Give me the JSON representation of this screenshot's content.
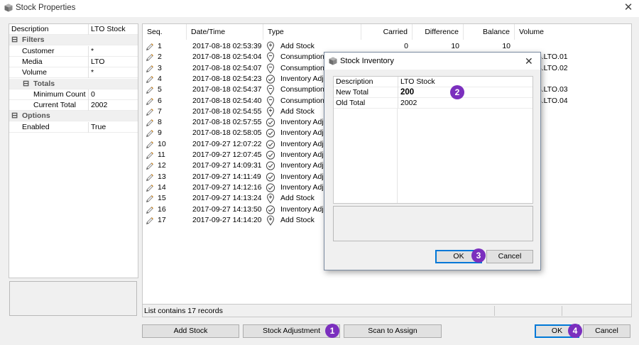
{
  "window": {
    "title": "Stock Properties",
    "close_glyph": "✕"
  },
  "properties": {
    "rows": [
      {
        "name": "Description",
        "value": "LTO Stock",
        "category": false,
        "toggle": "",
        "indent": 0
      },
      {
        "name": "Filters",
        "value": "",
        "category": true,
        "toggle": "⊟",
        "indent": 0
      },
      {
        "name": "Customer",
        "value": "*",
        "category": false,
        "toggle": "",
        "indent": 1
      },
      {
        "name": "Media",
        "value": "LTO",
        "category": false,
        "toggle": "",
        "indent": 1
      },
      {
        "name": "Volume",
        "value": "*",
        "category": false,
        "toggle": "",
        "indent": 1
      },
      {
        "name": "Totals",
        "value": "",
        "category": true,
        "toggle": "⊟",
        "indent": 1
      },
      {
        "name": "Minimum Count",
        "value": "0",
        "category": false,
        "toggle": "",
        "indent": 2
      },
      {
        "name": "Current Total",
        "value": "2002",
        "category": false,
        "toggle": "",
        "indent": 2
      },
      {
        "name": "Options",
        "value": "",
        "category": true,
        "toggle": "⊟",
        "indent": 0
      },
      {
        "name": "Enabled",
        "value": "True",
        "category": false,
        "toggle": "",
        "indent": 1
      }
    ]
  },
  "list": {
    "columns": [
      "Seq.",
      "Date/Time",
      "Type",
      "Carried",
      "Difference",
      "Balance",
      "Volume"
    ],
    "rows": [
      {
        "seq": "1",
        "datetime": "2017-08-18 02:53:39",
        "type": "Add Stock",
        "icon": "add-stock-icon",
        "carried": "0",
        "difference": "10",
        "balance": "10",
        "volume": ""
      },
      {
        "seq": "2",
        "datetime": "2017-08-18 02:54:04",
        "type": "Consumption",
        "icon": "consumption-icon",
        "carried": "",
        "difference": "",
        "balance": "",
        "volume": "18.LTO.01"
      },
      {
        "seq": "3",
        "datetime": "2017-08-18 02:54:07",
        "type": "Consumption",
        "icon": "consumption-icon",
        "carried": "",
        "difference": "",
        "balance": "",
        "volume": "18.LTO.02"
      },
      {
        "seq": "4",
        "datetime": "2017-08-18 02:54:23",
        "type": "Inventory Adju",
        "icon": "inventory-adjustment-icon",
        "carried": "",
        "difference": "",
        "balance": "",
        "volume": ""
      },
      {
        "seq": "5",
        "datetime": "2017-08-18 02:54:37",
        "type": "Consumption",
        "icon": "consumption-icon",
        "carried": "",
        "difference": "",
        "balance": "",
        "volume": "18.LTO.03"
      },
      {
        "seq": "6",
        "datetime": "2017-08-18 02:54:40",
        "type": "Consumption",
        "icon": "consumption-icon",
        "carried": "",
        "difference": "",
        "balance": "",
        "volume": "18.LTO.04"
      },
      {
        "seq": "7",
        "datetime": "2017-08-18 02:54:55",
        "type": "Add Stock",
        "icon": "add-stock-icon",
        "carried": "",
        "difference": "",
        "balance": "",
        "volume": ""
      },
      {
        "seq": "8",
        "datetime": "2017-08-18 02:57:55",
        "type": "Inventory Adju",
        "icon": "inventory-adjustment-icon",
        "carried": "",
        "difference": "",
        "balance": "",
        "volume": ""
      },
      {
        "seq": "9",
        "datetime": "2017-08-18 02:58:05",
        "type": "Inventory Adju",
        "icon": "inventory-adjustment-icon",
        "carried": "",
        "difference": "",
        "balance": "",
        "volume": ""
      },
      {
        "seq": "10",
        "datetime": "2017-09-27 12:07:22",
        "type": "Inventory Adju",
        "icon": "inventory-adjustment-icon",
        "carried": "",
        "difference": "",
        "balance": "",
        "volume": ""
      },
      {
        "seq": "11",
        "datetime": "2017-09-27 12:07:45",
        "type": "Inventory Adju",
        "icon": "inventory-adjustment-icon",
        "carried": "",
        "difference": "",
        "balance": "",
        "volume": ""
      },
      {
        "seq": "12",
        "datetime": "2017-09-27 14:09:31",
        "type": "Inventory Adju",
        "icon": "inventory-adjustment-icon",
        "carried": "",
        "difference": "",
        "balance": "",
        "volume": ""
      },
      {
        "seq": "13",
        "datetime": "2017-09-27 14:11:49",
        "type": "Inventory Adju",
        "icon": "inventory-adjustment-icon",
        "carried": "",
        "difference": "",
        "balance": "",
        "volume": ""
      },
      {
        "seq": "14",
        "datetime": "2017-09-27 14:12:16",
        "type": "Inventory Adju",
        "icon": "inventory-adjustment-icon",
        "carried": "",
        "difference": "",
        "balance": "",
        "volume": ""
      },
      {
        "seq": "15",
        "datetime": "2017-09-27 14:13:24",
        "type": "Add Stock",
        "icon": "add-stock-icon",
        "carried": "",
        "difference": "",
        "balance": "",
        "volume": ""
      },
      {
        "seq": "16",
        "datetime": "2017-09-27 14:13:50",
        "type": "Inventory Adju",
        "icon": "inventory-adjustment-icon",
        "carried": "",
        "difference": "",
        "balance": "",
        "volume": ""
      },
      {
        "seq": "17",
        "datetime": "2017-09-27 14:14:20",
        "type": "Add Stock",
        "icon": "add-stock-icon",
        "carried": "",
        "difference": "",
        "balance": "",
        "volume": ""
      }
    ]
  },
  "status": {
    "text": "List contains 17 records"
  },
  "buttons": {
    "add_stock": "Add Stock",
    "stock_adjustment": "Stock Adjustment",
    "scan_to_assign": "Scan to Assign",
    "ok": "OK",
    "cancel": "Cancel"
  },
  "dialog": {
    "title": "Stock Inventory",
    "close_glyph": "✕",
    "rows": [
      {
        "name": "Description",
        "value": "LTO Stock",
        "bold": false
      },
      {
        "name": "New Total",
        "value": "200",
        "bold": true
      },
      {
        "name": "Old Total",
        "value": "2002",
        "bold": false
      }
    ],
    "ok": "OK",
    "cancel": "Cancel"
  },
  "badges": {
    "b1": "1",
    "b2": "2",
    "b3": "3",
    "b4": "4"
  },
  "colors": {
    "badge": "#7b2fbe",
    "default_button_border": "#0078d7"
  }
}
